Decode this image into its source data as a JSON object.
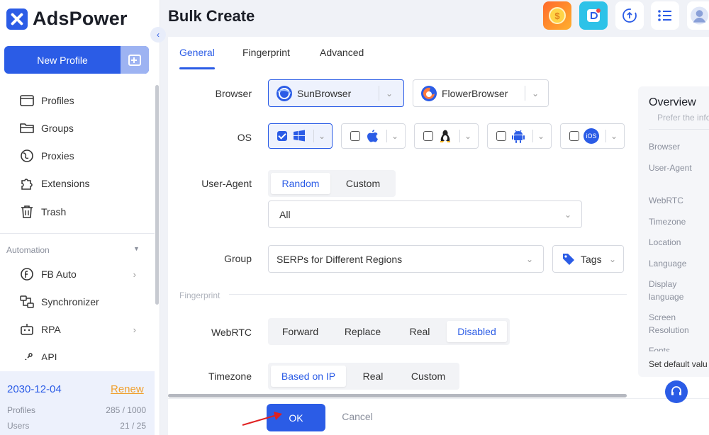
{
  "app": {
    "name": "AdsPower",
    "accent": "#2b5ce6"
  },
  "sidebar": {
    "new_profile_label": "New Profile",
    "items": [
      {
        "label": "Profiles",
        "icon": "profiles-icon"
      },
      {
        "label": "Groups",
        "icon": "folder-icon"
      },
      {
        "label": "Proxies",
        "icon": "proxy-icon"
      },
      {
        "label": "Extensions",
        "icon": "puzzle-icon"
      },
      {
        "label": "Trash",
        "icon": "trash-icon"
      }
    ],
    "automation_label": "Automation",
    "automation_items": [
      {
        "label": "FB Auto",
        "icon": "fb-auto-icon"
      },
      {
        "label": "Synchronizer",
        "icon": "synchronizer-icon"
      },
      {
        "label": "RPA",
        "icon": "rpa-icon"
      },
      {
        "label": "API",
        "icon": "api-icon"
      }
    ],
    "plan": {
      "expiry": "2030-12-04",
      "renew_label": "Renew",
      "profiles_label": "Profiles",
      "profiles_value": "285 / 1000",
      "users_label": "Users",
      "users_value": "21 / 25"
    }
  },
  "header": {
    "title": "Bulk Create"
  },
  "tabs": [
    {
      "label": "General"
    },
    {
      "label": "Fingerprint"
    },
    {
      "label": "Advanced"
    }
  ],
  "form": {
    "browser_label": "Browser",
    "browsers": [
      {
        "label": "SunBrowser"
      },
      {
        "label": "FlowerBrowser"
      }
    ],
    "os_label": "OS",
    "os_ios_label": "iOS",
    "ua_label": "User-Agent",
    "ua_options": [
      "Random",
      "Custom"
    ],
    "ua_select": "All",
    "group_label": "Group",
    "group_value": "SERPs for Different Regions",
    "tags_label": "Tags",
    "fingerprint_section": "Fingerprint",
    "webrtc_label": "WebRTC",
    "webrtc_options": [
      "Forward",
      "Replace",
      "Real",
      "Disabled"
    ],
    "timezone_label": "Timezone",
    "timezone_options": [
      "Based on IP",
      "Real",
      "Custom"
    ]
  },
  "overview": {
    "title": "Overview",
    "subtitle": "Prefer the info",
    "items": [
      "Browser",
      "User-Agent",
      "WebRTC",
      "Timezone",
      "Location",
      "Language",
      "Display language",
      "Screen Resolution",
      "Fonts"
    ],
    "default_label": "Set default valu"
  },
  "footer": {
    "ok_label": "OK",
    "cancel_label": "Cancel"
  }
}
